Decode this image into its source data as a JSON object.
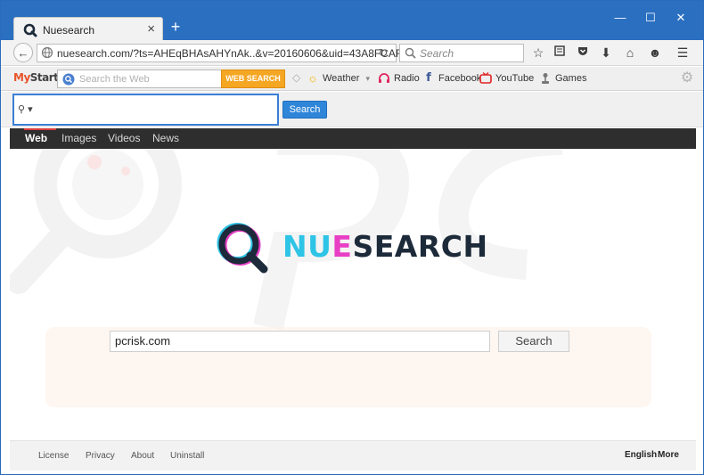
{
  "window": {
    "tab_title": "Nuesearch",
    "tab_close": "×",
    "new_tab": "+",
    "minimize": "—",
    "maximize": "☐",
    "close": "✕"
  },
  "navbar": {
    "url": "nuesearch.com/?ts=AHEqBHAsAHYnAk..&v=20160606&uid=43A8FCAF6",
    "search_placeholder": "Search"
  },
  "mystart": {
    "logo_m": "My",
    "logo_rest": "Start",
    "search_placeholder": "Search the Web",
    "web_search_label": "WEB SEARCH",
    "items": [
      {
        "label": "Weather"
      },
      {
        "label": "Radio"
      },
      {
        "label": "Facebook"
      },
      {
        "label": "YouTube"
      },
      {
        "label": "Games"
      }
    ]
  },
  "band": {
    "input_value": "",
    "button_label": "Search"
  },
  "darknav": {
    "items": [
      {
        "label": "Web",
        "active": true
      },
      {
        "label": "Images",
        "active": false
      },
      {
        "label": "Videos",
        "active": false
      },
      {
        "label": "News",
        "active": false
      }
    ]
  },
  "logo": {
    "part1": "NU",
    "part2": "E",
    "part3": "SEARCH"
  },
  "main": {
    "search_value": "pcrisk.com",
    "search_button": "Search"
  },
  "footer": {
    "links": [
      "License",
      "Privacy",
      "About",
      "Uninstall"
    ],
    "language": "English",
    "more": "More"
  },
  "colors": {
    "chrome_blue": "#2b6fc0",
    "accent_orange": "#f5a623",
    "logo_cyan": "#2ec4e6",
    "logo_magenta": "#e83fc5",
    "logo_dark": "#1c2a3a",
    "band_button": "#2f86d9"
  }
}
